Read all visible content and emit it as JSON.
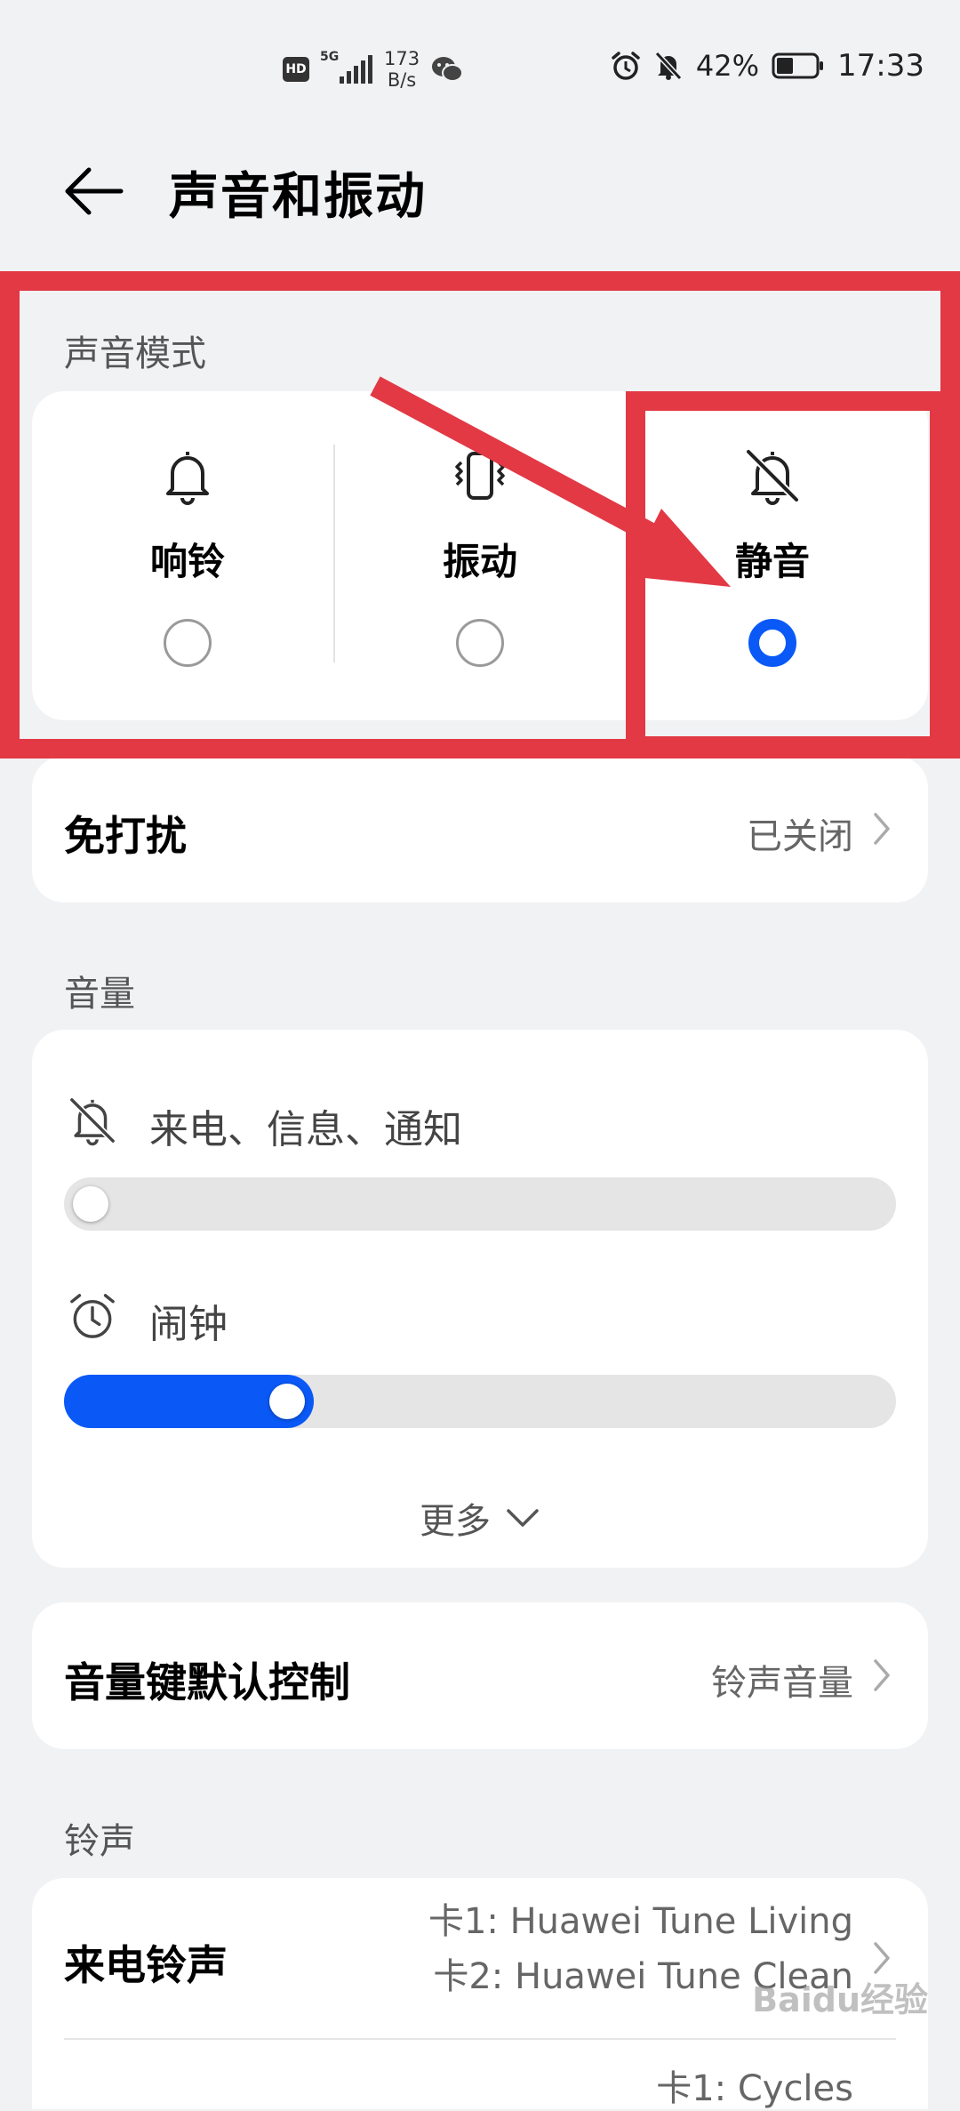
{
  "status_bar": {
    "hd": "HD",
    "network": "5G",
    "speed_value": "173",
    "speed_unit": "B/s",
    "battery_percent": "42%",
    "time": "17:33",
    "battery_level": 0.42
  },
  "header": {
    "title": "声音和振动"
  },
  "sound_mode": {
    "section_label": "声音模式",
    "options": [
      {
        "label": "响铃",
        "icon": "bell-icon",
        "selected": false
      },
      {
        "label": "振动",
        "icon": "vibrate-icon",
        "selected": false
      },
      {
        "label": "静音",
        "icon": "bell-off-icon",
        "selected": true
      }
    ]
  },
  "dnd": {
    "label": "免打扰",
    "value": "已关闭"
  },
  "volume": {
    "section_label": "音量",
    "items": [
      {
        "label": "来电、信息、通知",
        "icon": "bell-off-icon",
        "level": 0
      },
      {
        "label": "闹钟",
        "icon": "alarm-icon",
        "level": 0.3
      }
    ],
    "more_label": "更多"
  },
  "volume_key": {
    "label": "音量键默认控制",
    "value": "铃声音量"
  },
  "ringtone": {
    "section_label": "铃声",
    "incoming": {
      "label": "来电铃声",
      "value_line1": "卡1: Huawei Tune Living",
      "value_line2": "卡2: Huawei Tune Clean"
    },
    "next_row_partial": "卡1: Cycles"
  },
  "watermark": "Baidu经验",
  "colors": {
    "accent": "#0a59f7",
    "annotation": "#e23945",
    "background": "#f1f2f4"
  }
}
